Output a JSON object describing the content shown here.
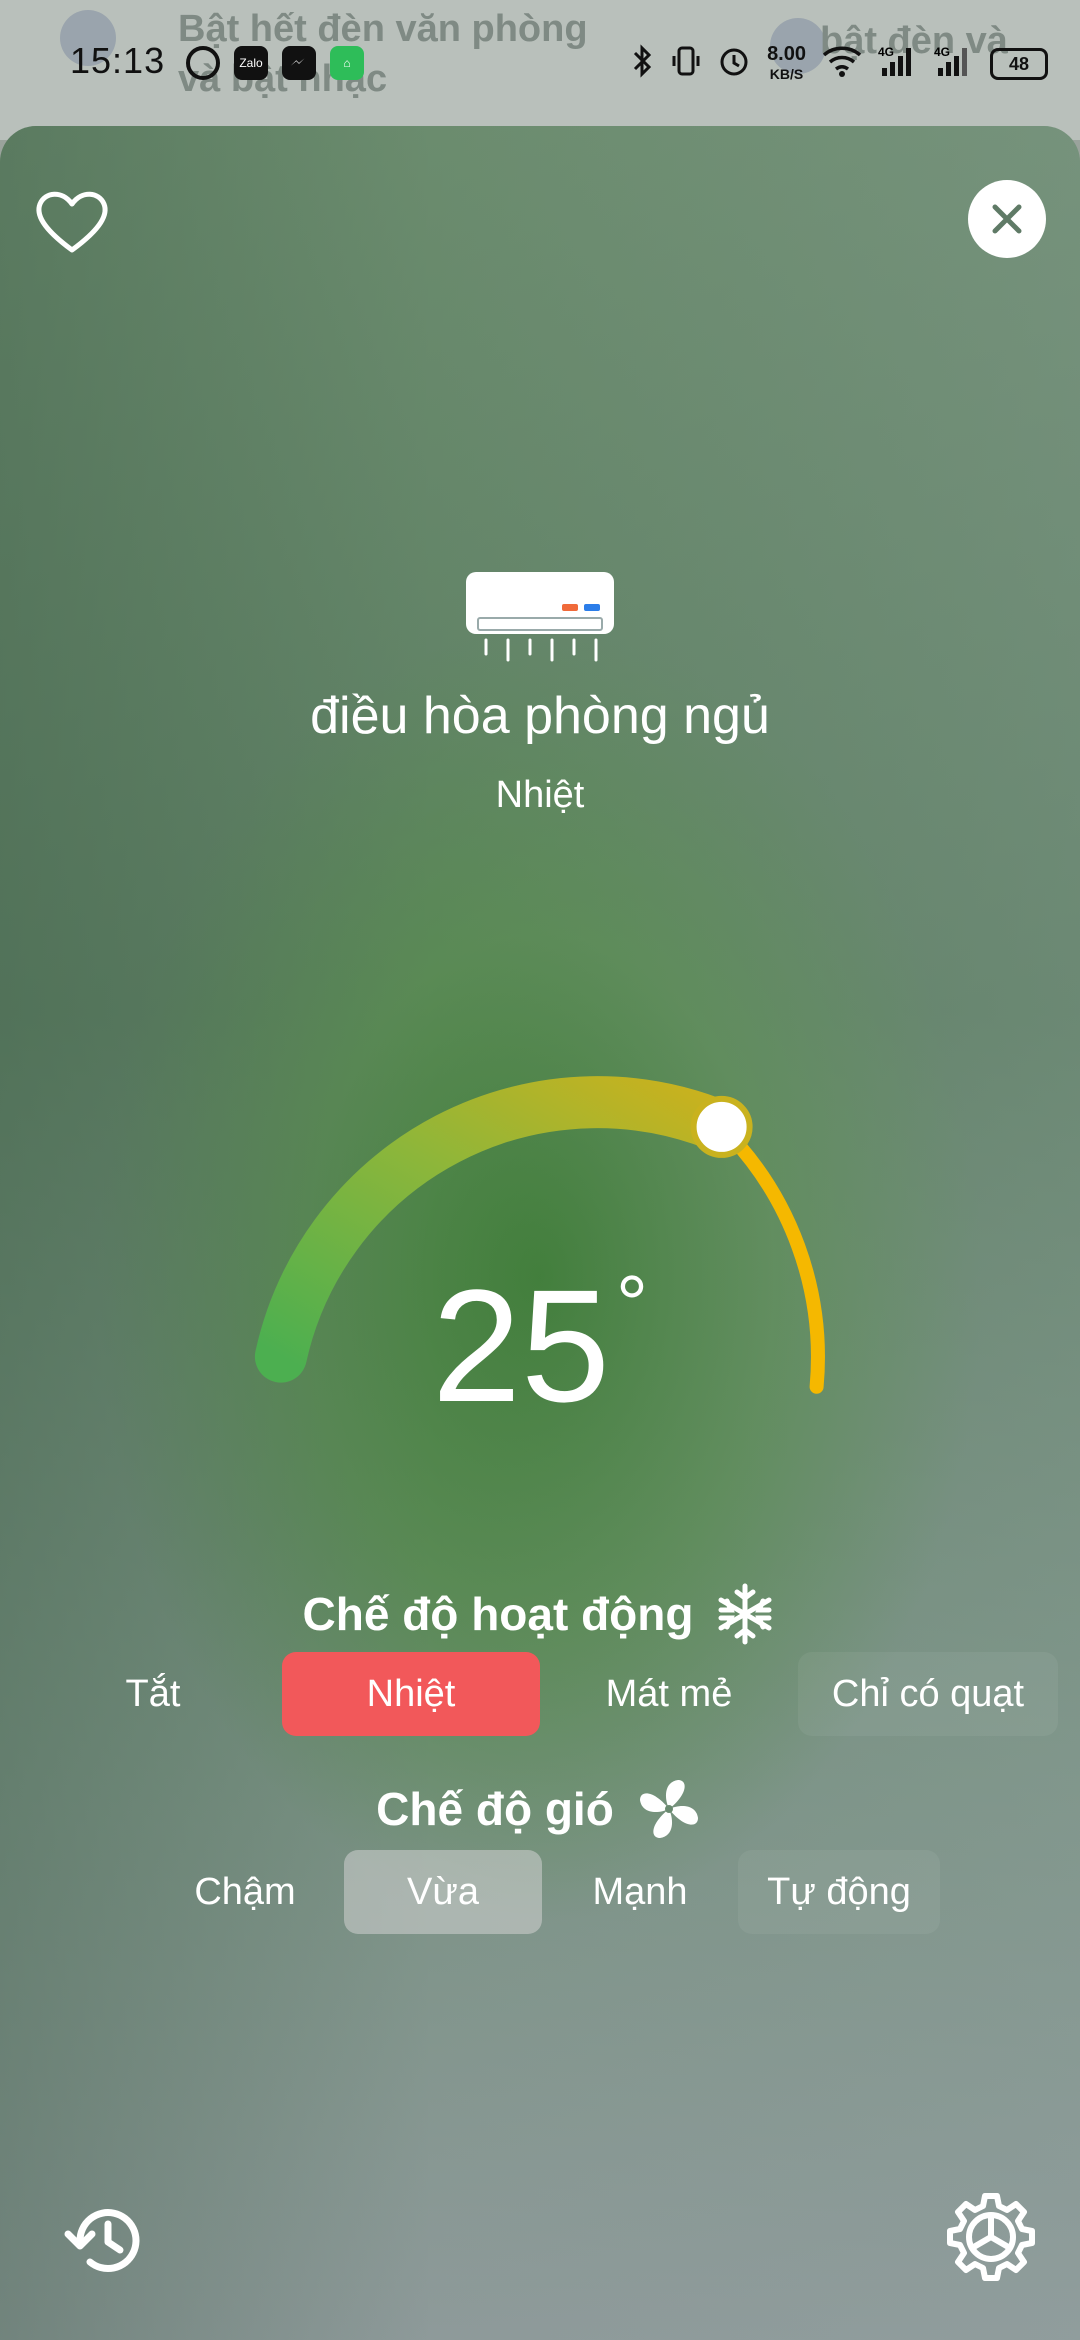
{
  "status_bar": {
    "time": "15:13",
    "speed_value": "8.00",
    "speed_unit": "KB/S",
    "battery": "48",
    "icons": [
      "autoplay-icon",
      "zalo-icon",
      "messenger-icon",
      "app-icon",
      "bluetooth-icon",
      "vibrate-icon",
      "alarm-icon",
      "wifi-icon",
      "signal-4g-icon",
      "signal-4g-icon",
      "battery-icon"
    ]
  },
  "background": {
    "item1": "Bật hết đèn văn phòng",
    "item1b": "và bật nhạc",
    "item2": "bật đèn và"
  },
  "device": {
    "name": "điều hòa phòng ngủ",
    "mode": "Nhiệt",
    "temperature": "25",
    "degree": "°"
  },
  "operation_mode": {
    "title": "Chế độ hoạt động",
    "icon": "snowflake-icon",
    "options": [
      "Tắt",
      "Nhiệt",
      "Mát mẻ",
      "Chỉ có quạt"
    ],
    "selected": "Nhiệt"
  },
  "fan_mode": {
    "title": "Chế độ gió",
    "icon": "fan-icon",
    "options": [
      "Chậm",
      "Vừa",
      "Mạnh",
      "Tự động"
    ],
    "selected": "Vừa"
  },
  "colors": {
    "active_red": "#f2585a",
    "dial_start": "#4caf50",
    "dial_end": "#f5b800"
  }
}
